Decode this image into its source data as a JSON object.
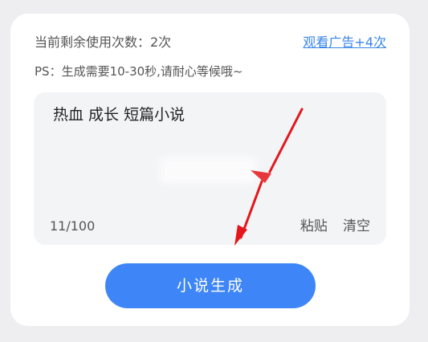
{
  "usage": {
    "remaining_label": "当前剩余使用次数：2次",
    "watch_ad_link": "观看广告+4次"
  },
  "ps_note": "PS：生成需要10-30秒,请耐心等候哦~",
  "editor": {
    "content": "热血 成长 短篇小说",
    "char_count": "11/100",
    "paste_label": "粘贴",
    "clear_label": "清空"
  },
  "generate_button_label": "小说生成",
  "colors": {
    "accent": "#3e86f7",
    "link": "#3a86e8",
    "annotation_arrow": "#e3161b"
  },
  "annotation": {
    "icon": "red-arrow-icon"
  }
}
